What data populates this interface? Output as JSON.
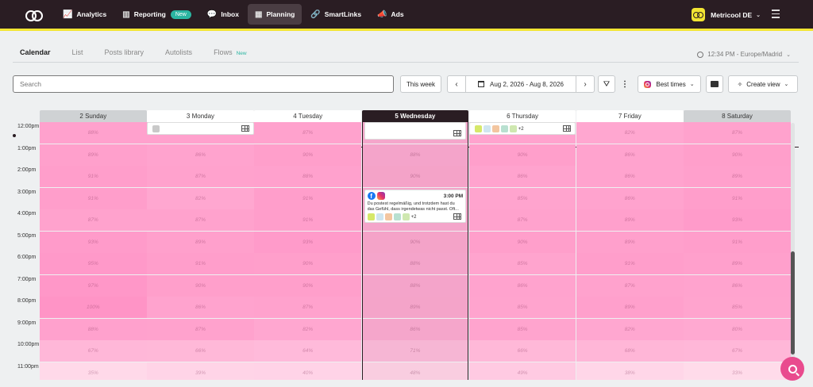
{
  "nav": {
    "items": [
      {
        "label": "Analytics",
        "icon": "chart-line-icon",
        "glyph": "📈"
      },
      {
        "label": "Reporting",
        "icon": "bar-chart-icon",
        "glyph": "▥",
        "badge": "New"
      },
      {
        "label": "Inbox",
        "icon": "chat-icon",
        "glyph": "💬"
      },
      {
        "label": "Planning",
        "icon": "calendar-icon",
        "glyph": "▦",
        "active": true
      },
      {
        "label": "SmartLinks",
        "icon": "link-icon",
        "glyph": "🔗"
      },
      {
        "label": "Ads",
        "icon": "megaphone-icon",
        "glyph": "📣"
      }
    ],
    "account": "Metricool DE"
  },
  "subtabs": [
    {
      "label": "Calendar",
      "active": true
    },
    {
      "label": "List"
    },
    {
      "label": "Posts library"
    },
    {
      "label": "Autolists"
    },
    {
      "label": "Flows",
      "badge": "New"
    }
  ],
  "timezone": "12:34 PM - Europe/Madrid",
  "toolbar": {
    "search_placeholder": "Search",
    "this_week": "This week",
    "date_range": "Aug 2, 2026 - Aug 8, 2026",
    "best_times": "Best times",
    "create_view": "Create view"
  },
  "calendar": {
    "days": [
      {
        "label": "2 Sunday",
        "type": "weekend"
      },
      {
        "label": "3 Monday",
        "type": "weekday"
      },
      {
        "label": "4 Tuesday",
        "type": "weekday"
      },
      {
        "label": "5 Wednesday",
        "type": "today"
      },
      {
        "label": "6 Thursday",
        "type": "weekday"
      },
      {
        "label": "7 Friday",
        "type": "weekday"
      },
      {
        "label": "8 Saturday",
        "type": "weekend"
      }
    ],
    "hours": [
      "12:00pm",
      "1:00pm",
      "2:00pm",
      "3:00pm",
      "4:00pm",
      "5:00pm",
      "6:00pm",
      "7:00pm",
      "8:00pm",
      "9:00pm",
      "10:00pm",
      "11:00pm"
    ],
    "best_times": [
      [
        88,
        89,
        91,
        91,
        87,
        93,
        95,
        97,
        100,
        88,
        67,
        35
      ],
      [
        88,
        86,
        87,
        82,
        87,
        89,
        91,
        90,
        86,
        87,
        66,
        39
      ],
      [
        87,
        90,
        88,
        91,
        91,
        93,
        90,
        90,
        87,
        82,
        64,
        40
      ],
      [
        86,
        88,
        90,
        88,
        87,
        90,
        88,
        88,
        89,
        86,
        71,
        48
      ],
      [
        86,
        90,
        86,
        85,
        87,
        90,
        85,
        86,
        85,
        85,
        66,
        49
      ],
      [
        82,
        86,
        86,
        86,
        89,
        89,
        91,
        87,
        89,
        82,
        68,
        38
      ],
      [
        87,
        90,
        89,
        91,
        93,
        91,
        89,
        86,
        85,
        80,
        67,
        33
      ]
    ],
    "posts": {
      "monday_count": "",
      "thursday_more": "+2",
      "wednesday_time": "3:00 PM",
      "wednesday_text": "Du postest regelmäßig, und trotzdem hast du das Gefühl, dass irgendetwas nicht passt. Oft...",
      "wednesday_more": "+2"
    }
  },
  "colors": {
    "nav_bg": "#2a1d23",
    "accent_yellow": "#f2e533",
    "heat_high": "#ff94c2",
    "heat_low": "#ffd1e4",
    "fab": "#e94b8e"
  }
}
